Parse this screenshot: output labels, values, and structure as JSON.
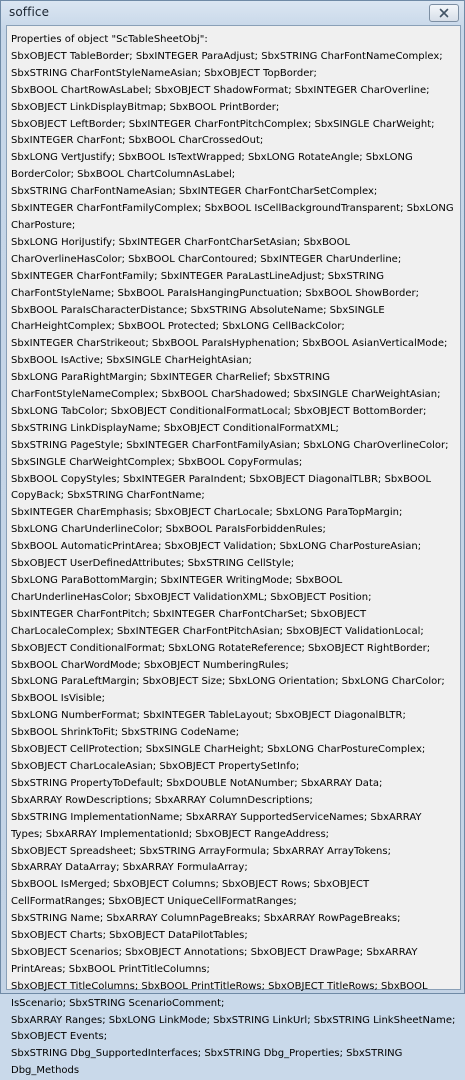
{
  "window": {
    "title": "soffice",
    "close_icon": "close-icon"
  },
  "message": {
    "lines": [
      "Properties of object \"ScTableSheetObj\":",
      "SbxOBJECT TableBorder; SbxINTEGER ParaAdjust; SbxSTRING CharFontNameComplex; SbxSTRING CharFontStyleNameAsian; SbxOBJECT TopBorder;",
      "SbxBOOL ChartRowAsLabel; SbxOBJECT ShadowFormat; SbxINTEGER CharOverline; SbxOBJECT LinkDisplayBitmap; SbxBOOL PrintBorder;",
      "SbxOBJECT LeftBorder; SbxINTEGER CharFontPitchComplex; SbxSINGLE CharWeight; SbxINTEGER CharFont; SbxBOOL CharCrossedOut;",
      "SbxLONG VertJustify; SbxBOOL IsTextWrapped; SbxLONG RotateAngle; SbxLONG BorderColor; SbxBOOL ChartColumnAsLabel;",
      "SbxSTRING CharFontNameAsian; SbxINTEGER CharFontCharSetComplex;",
      "SbxINTEGER CharFontFamilyComplex; SbxBOOL IsCellBackgroundTransparent; SbxLONG CharPosture;",
      "SbxLONG HoriJustify; SbxINTEGER CharFontCharSetAsian; SbxBOOL CharOverlineHasColor; SbxBOOL CharContoured; SbxINTEGER CharUnderline;",
      "SbxINTEGER CharFontFamily; SbxINTEGER ParaLastLineAdjust; SbxSTRING CharFontStyleName; SbxBOOL ParaIsHangingPunctuation; SbxBOOL ShowBorder;",
      "SbxBOOL ParaIsCharacterDistance; SbxSTRING AbsoluteName; SbxSINGLE CharHeightComplex; SbxBOOL Protected; SbxLONG CellBackColor;",
      "SbxINTEGER CharStrikeout; SbxBOOL ParaIsHyphenation; SbxBOOL AsianVerticalMode; SbxBOOL IsActive; SbxSINGLE CharHeightAsian;",
      "SbxLONG ParaRightMargin; SbxINTEGER CharRelief; SbxSTRING CharFontStyleNameComplex; SbxBOOL CharShadowed; SbxSINGLE CharWeightAsian;",
      "SbxLONG TabColor; SbxOBJECT ConditionalFormatLocal; SbxOBJECT BottomBorder;",
      "SbxSTRING LinkDisplayName; SbxOBJECT ConditionalFormatXML;",
      "SbxSTRING PageStyle; SbxINTEGER CharFontFamilyAsian; SbxLONG CharOverlineColor; SbxSINGLE CharWeightComplex; SbxBOOL CopyFormulas;",
      "SbxBOOL CopyStyles; SbxINTEGER ParaIndent; SbxOBJECT DiagonalTLBR; SbxBOOL CopyBack; SbxSTRING CharFontName;",
      "SbxINTEGER CharEmphasis; SbxOBJECT CharLocale; SbxLONG ParaTopMargin;",
      "SbxLONG CharUnderlineColor; SbxBOOL ParaIsForbiddenRules;",
      "SbxBOOL AutomaticPrintArea; SbxOBJECT Validation; SbxLONG CharPostureAsian;",
      "SbxOBJECT UserDefinedAttributes; SbxSTRING CellStyle;",
      "SbxLONG ParaBottomMargin; SbxINTEGER WritingMode; SbxBOOL CharUnderlineHasColor; SbxOBJECT ValidationXML; SbxOBJECT Position;",
      "SbxINTEGER CharFontPitch; SbxINTEGER CharFontCharSet; SbxOBJECT CharLocaleComplex; SbxINTEGER CharFontPitchAsian; SbxOBJECT ValidationLocal;",
      "SbxOBJECT ConditionalFormat; SbxLONG RotateReference; SbxOBJECT RightBorder;",
      "SbxBOOL CharWordMode; SbxOBJECT NumberingRules;",
      "SbxLONG ParaLeftMargin; SbxOBJECT Size; SbxLONG Orientation; SbxLONG CharColor; SbxBOOL IsVisible;",
      "SbxLONG NumberFormat; SbxINTEGER TableLayout; SbxOBJECT DiagonalBLTR;",
      "SbxBOOL ShrinkToFit; SbxSTRING CodeName;",
      "SbxOBJECT CellProtection; SbxSINGLE CharHeight; SbxLONG CharPostureComplex;",
      "SbxOBJECT CharLocaleAsian; SbxOBJECT PropertySetInfo;",
      "SbxSTRING PropertyToDefault; SbxDOUBLE NotANumber; SbxARRAY Data;",
      "SbxARRAY RowDescriptions; SbxARRAY ColumnDescriptions;",
      "SbxSTRING ImplementationName; SbxARRAY SupportedServiceNames; SbxARRAY Types; SbxARRAY ImplementationId; SbxOBJECT RangeAddress;",
      "SbxOBJECT Spreadsheet; SbxSTRING ArrayFormula; SbxARRAY ArrayTokens;",
      "SbxARRAY DataArray; SbxARRAY FormulaArray;",
      "SbxBOOL IsMerged; SbxOBJECT Columns; SbxOBJECT Rows; SbxOBJECT CellFormatRanges; SbxOBJECT UniqueCellFormatRanges;",
      "SbxSTRING Name; SbxARRAY ColumnPageBreaks; SbxARRAY RowPageBreaks;",
      "SbxOBJECT Charts; SbxOBJECT DataPilotTables;",
      "SbxOBJECT Scenarios; SbxOBJECT Annotations; SbxOBJECT DrawPage; SbxARRAY PrintAreas; SbxBOOL PrintTitleColumns;",
      "SbxOBJECT TitleColumns; SbxBOOL PrintTitleRows; SbxOBJECT TitleRows; SbxBOOL IsScenario; SbxSTRING ScenarioComment;",
      "SbxARRAY Ranges; SbxLONG LinkMode; SbxSTRING LinkUrl; SbxSTRING LinkSheetName; SbxOBJECT Events;",
      "SbxSTRING Dbg_SupportedInterfaces; SbxSTRING Dbg_Properties; SbxSTRING Dbg_Methods"
    ]
  }
}
